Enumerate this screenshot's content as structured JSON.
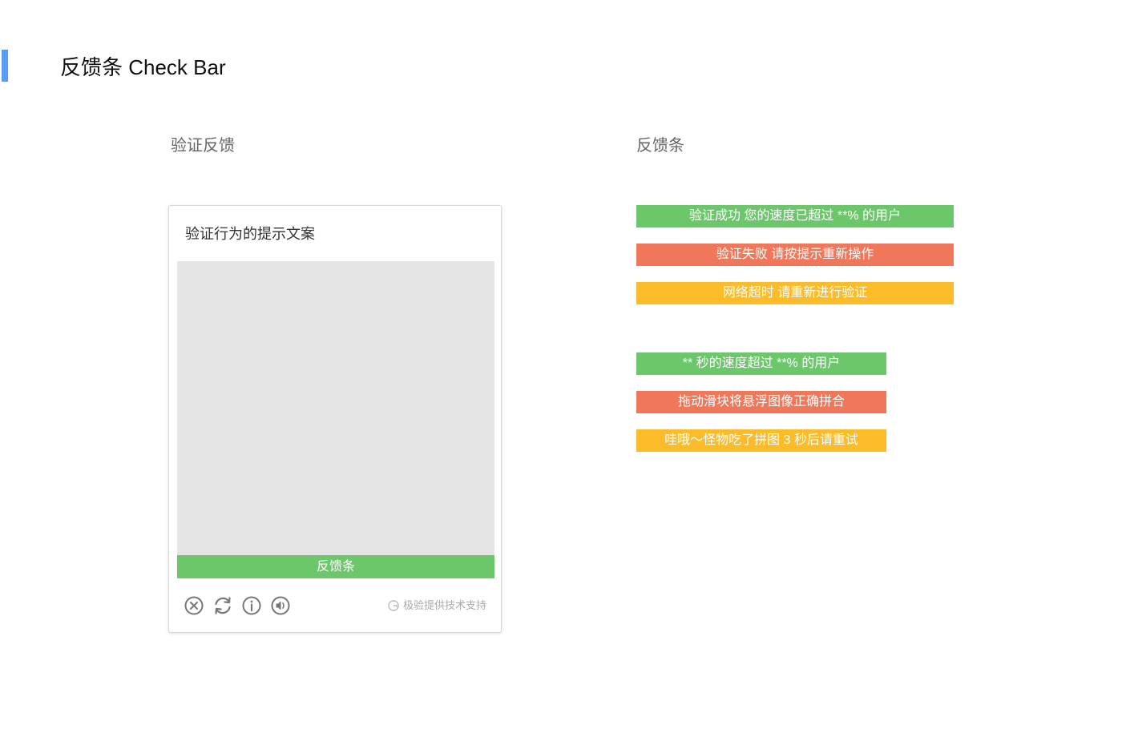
{
  "page": {
    "title": "反馈条 Check Bar"
  },
  "sections": {
    "verify_feedback_title": "验证反馈",
    "feedback_bar_title": "反馈条"
  },
  "captcha": {
    "prompt": "验证行为的提示文案",
    "feedback_label": "反馈条",
    "brand_text": "极验提供技术支持",
    "icons": [
      "close-icon",
      "refresh-icon",
      "info-icon",
      "audio-icon"
    ]
  },
  "bars": {
    "group1": [
      {
        "text": "验证成功 您的速度已超过 **% 的用户",
        "status": "success"
      },
      {
        "text": "验证失败 请按提示重新操作",
        "status": "error"
      },
      {
        "text": "网络超时 请重新进行验证",
        "status": "warning"
      }
    ],
    "group2": [
      {
        "text": "** 秒的速度超过 **% 的用户",
        "status": "success"
      },
      {
        "text": "拖动滑块将悬浮图像正确拼合",
        "status": "error"
      },
      {
        "text": "哇哦～怪物吃了拼图 3 秒后请重试",
        "status": "warning"
      }
    ]
  },
  "colors": {
    "accent": "#5b9cf5",
    "success": "#6cc76b",
    "error": "#f0775a",
    "warning": "#fcbb29",
    "icon_gray": "#777777"
  }
}
